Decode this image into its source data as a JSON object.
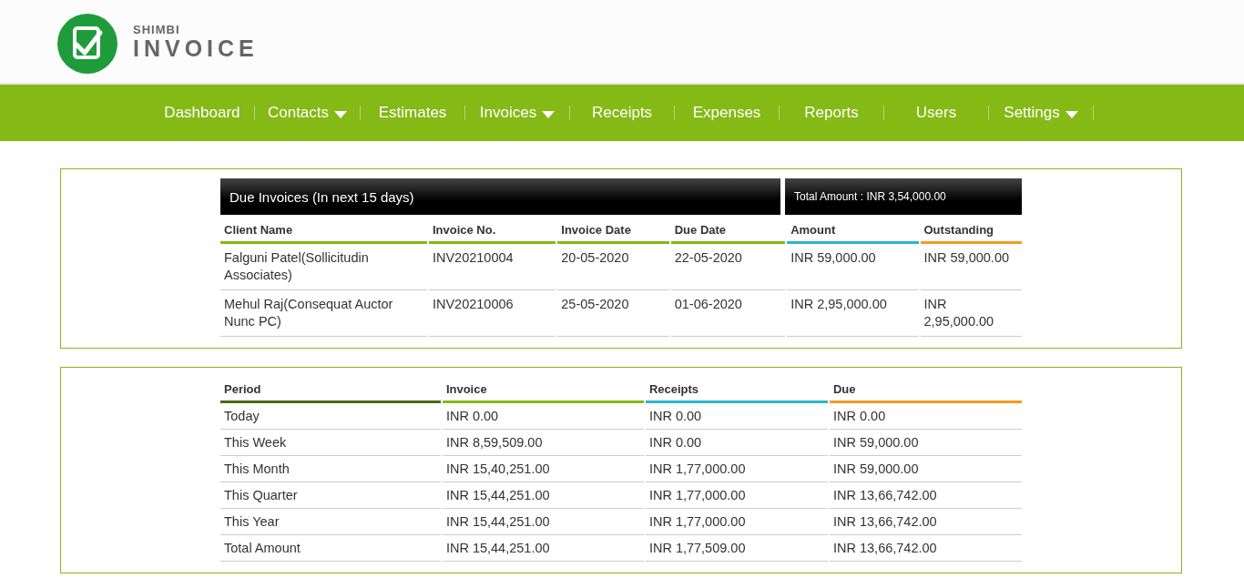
{
  "brand": {
    "small": "SHIMBI",
    "large": "INVOICE"
  },
  "nav": [
    {
      "label": "Dashboard",
      "dropdown": false
    },
    {
      "label": "Contacts",
      "dropdown": true
    },
    {
      "label": "Estimates",
      "dropdown": false
    },
    {
      "label": "Invoices",
      "dropdown": true
    },
    {
      "label": "Receipts",
      "dropdown": false
    },
    {
      "label": "Expenses",
      "dropdown": false
    },
    {
      "label": "Reports",
      "dropdown": false
    },
    {
      "label": "Users",
      "dropdown": false
    },
    {
      "label": "Settings",
      "dropdown": true
    }
  ],
  "due_invoices": {
    "title": "Due Invoices (In next 15 days)",
    "total": "Total Amount : INR 3,54,000.00",
    "columns": [
      {
        "label": "Client Name",
        "color": "#84b916"
      },
      {
        "label": "Invoice No.",
        "color": "#84b916"
      },
      {
        "label": "Invoice Date",
        "color": "#84b916"
      },
      {
        "label": "Due Date",
        "color": "#84b916"
      },
      {
        "label": "Amount",
        "color": "#2bb5c9"
      },
      {
        "label": "Outstanding",
        "color": "#f39c1a"
      }
    ],
    "rows": [
      [
        " Falguni Patel(Sollicitudin Associates)",
        " INV20210004",
        "20-05-2020",
        "22-05-2020",
        "INR 59,000.00",
        "INR 59,000.00"
      ],
      [
        " Mehul Raj(Consequat Auctor Nunc PC)",
        " INV20210006",
        "25-05-2020",
        "01-06-2020",
        "INR 2,95,000.00",
        "INR 2,95,000.00"
      ]
    ]
  },
  "summary": {
    "columns": [
      {
        "label": "Period",
        "color": "#4a6b12"
      },
      {
        "label": "Invoice",
        "color": "#84b916"
      },
      {
        "label": "Receipts",
        "color": "#2bb5c9"
      },
      {
        "label": "Due",
        "color": "#f39c1a"
      }
    ],
    "rows": [
      [
        "Today",
        "INR 0.00",
        "INR 0.00",
        "INR 0.00"
      ],
      [
        "This Week",
        "INR 8,59,509.00",
        "INR 0.00",
        "INR 59,000.00"
      ],
      [
        "This Month",
        "INR 15,40,251.00",
        "INR 1,77,000.00",
        "INR 59,000.00"
      ],
      [
        "This Quarter",
        "INR 15,44,251.00",
        "INR 1,77,000.00",
        "INR 13,66,742.00"
      ],
      [
        "This Year",
        "INR 15,44,251.00",
        "INR 1,77,000.00",
        "INR 13,66,742.00"
      ],
      [
        "Total Amount",
        "INR 15,44,251.00",
        "INR 1,77,509.00",
        "INR 13,66,742.00"
      ]
    ]
  }
}
